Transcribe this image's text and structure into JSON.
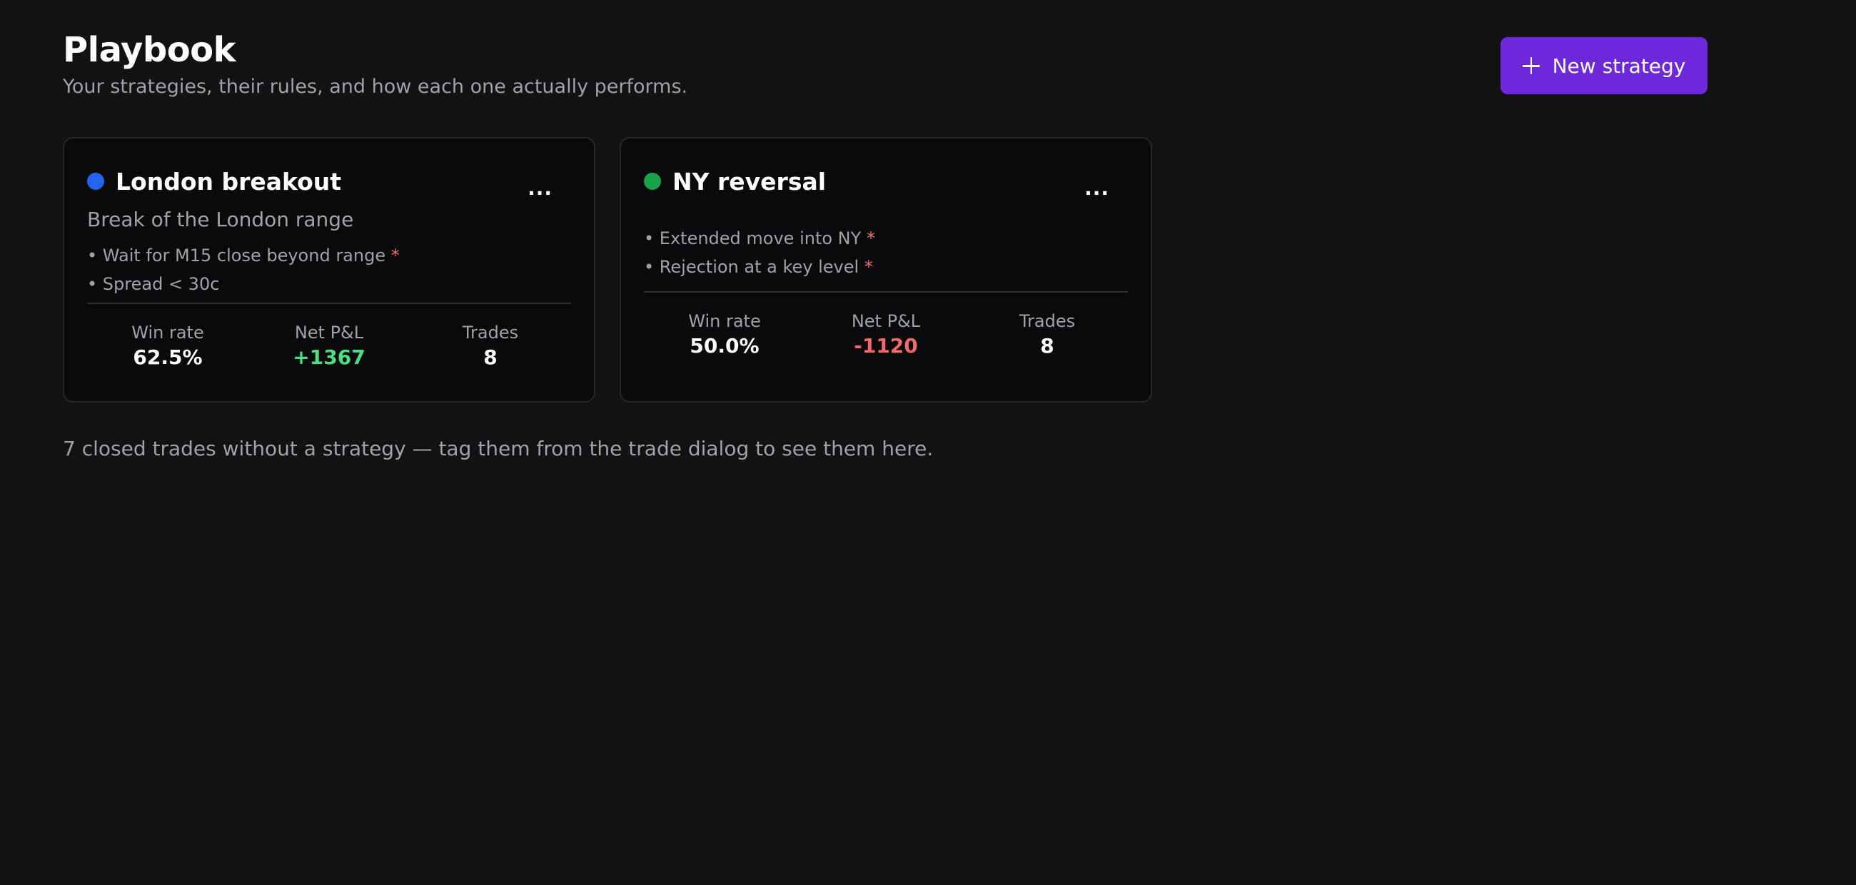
{
  "header": {
    "title": "Playbook",
    "subtitle": "Your strategies, their rules, and how each one actually performs."
  },
  "actions": {
    "new_strategy_label": "New strategy",
    "icon": "plus-icon"
  },
  "strategies": [
    {
      "name": "London breakout",
      "color": "#2563eb",
      "description": "Break of the London range",
      "rules": [
        {
          "text": "Wait for M15 close beyond range",
          "required_marker": "*"
        },
        {
          "text": "Spread < 30c",
          "required_marker": ""
        }
      ],
      "more_label": "...",
      "stats": {
        "win_rate_label": "Win rate",
        "win_rate": "62.5%",
        "net_pnl_label": "Net P&L",
        "net_pnl": "+1367",
        "net_pnl_color": "#4ade80",
        "trades_label": "Trades",
        "trades": "8"
      }
    },
    {
      "name": "NY reversal",
      "color": "#16a34a",
      "description": "",
      "rules": [
        {
          "text": "Extended move into NY",
          "required_marker": "*"
        },
        {
          "text": "Rejection at a key level",
          "required_marker": "*"
        }
      ],
      "more_label": "...",
      "stats": {
        "win_rate_label": "Win rate",
        "win_rate": "50.0%",
        "net_pnl_label": "Net P&L",
        "net_pnl": "-1120",
        "net_pnl_color": "#f06a6a",
        "trades_label": "Trades",
        "trades": "8"
      }
    }
  ],
  "footnote": "7 closed trades without a strategy — tag them from the trade dialog to see them here."
}
